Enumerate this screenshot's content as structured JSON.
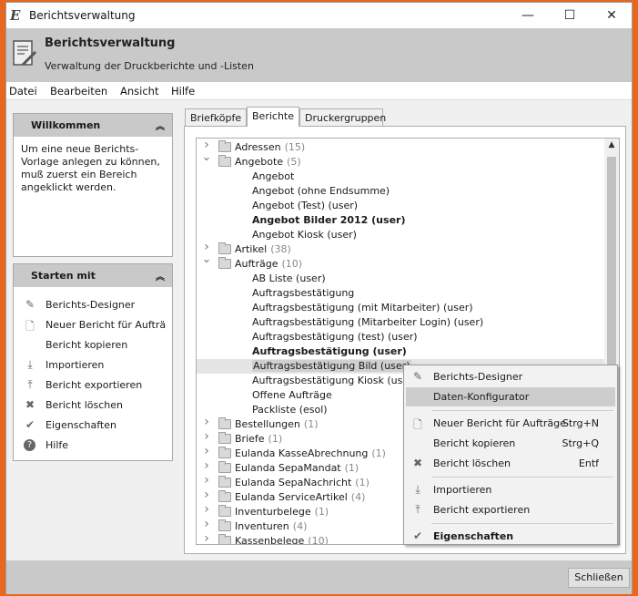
{
  "window": {
    "title": "Berichtsverwaltung",
    "controls": {
      "minimize": "—",
      "maximize": "☐",
      "close": "✕"
    }
  },
  "header": {
    "title": "Berichtsverwaltung",
    "subtitle": "Verwaltung der Druckberichte und -Listen"
  },
  "menu": [
    "Datei",
    "Bearbeiten",
    "Ansicht",
    "Hilfe"
  ],
  "welcome": {
    "title": "Willkommen",
    "text": "Um eine neue Berichts-Vorlage anlegen zu können, muß zuerst ein Bereich angeklickt werden."
  },
  "start": {
    "title": "Starten mit",
    "items": [
      {
        "label": "Berichts-Designer",
        "icon": "pencil-icon"
      },
      {
        "label": "Neuer Bericht für Aufträ",
        "icon": "new-document-icon"
      },
      {
        "label": "Bericht kopieren",
        "icon": ""
      },
      {
        "label": "Importieren",
        "icon": "import-icon"
      },
      {
        "label": "Bericht exportieren",
        "icon": "export-icon"
      },
      {
        "label": "Bericht löschen",
        "icon": "delete-icon"
      },
      {
        "label": "Eigenschaften",
        "icon": "properties-icon"
      },
      {
        "label": "Hilfe",
        "icon": "help-icon"
      }
    ]
  },
  "tabs": [
    "Briefköpfe",
    "Berichte",
    "Druckergruppen"
  ],
  "active_tab": 1,
  "tree": [
    {
      "type": "folder",
      "label": "Adressen",
      "count": "(15)",
      "expanded": false
    },
    {
      "type": "folder",
      "label": "Angebote",
      "count": "(5)",
      "expanded": true
    },
    {
      "type": "leaf",
      "label": "Angebot"
    },
    {
      "type": "leaf",
      "label": "Angebot (ohne Endsumme)"
    },
    {
      "type": "leaf",
      "label": "Angebot (Test) (user)"
    },
    {
      "type": "leaf",
      "label": "Angebot Bilder 2012 (user)",
      "bold": true
    },
    {
      "type": "leaf",
      "label": "Angebot Kiosk (user)"
    },
    {
      "type": "folder",
      "label": "Artikel",
      "count": "(38)",
      "expanded": false
    },
    {
      "type": "folder",
      "label": "Aufträge",
      "count": "(10)",
      "expanded": true
    },
    {
      "type": "leaf",
      "label": "AB Liste (user)"
    },
    {
      "type": "leaf",
      "label": "Auftragsbestätigung"
    },
    {
      "type": "leaf",
      "label": "Auftragsbestätigung (mit Mitarbeiter) (user)"
    },
    {
      "type": "leaf",
      "label": "Auftragsbestätigung (Mitarbeiter Login) (user)"
    },
    {
      "type": "leaf",
      "label": "Auftragsbestätigung (test) (user)"
    },
    {
      "type": "leaf",
      "label": "Auftragsbestätigung (user)",
      "bold": true
    },
    {
      "type": "leaf",
      "label": "Auftragsbestätigung Bild (user)",
      "selected": true
    },
    {
      "type": "leaf",
      "label": "Auftragsbestätigung Kiosk (user)"
    },
    {
      "type": "leaf",
      "label": "Offene Aufträge"
    },
    {
      "type": "leaf",
      "label": "Packliste (esol)"
    },
    {
      "type": "folder",
      "label": "Bestellungen",
      "count": "(1)",
      "expanded": false
    },
    {
      "type": "folder",
      "label": "Briefe",
      "count": "(1)",
      "expanded": false
    },
    {
      "type": "folder",
      "label": "Eulanda KasseAbrechnung",
      "count": "(1)",
      "expanded": false
    },
    {
      "type": "folder",
      "label": "Eulanda SepaMandat",
      "count": "(1)",
      "expanded": false
    },
    {
      "type": "folder",
      "label": "Eulanda SepaNachricht",
      "count": "(1)",
      "expanded": false
    },
    {
      "type": "folder",
      "label": "Eulanda ServiceArtikel",
      "count": "(4)",
      "expanded": false
    },
    {
      "type": "folder",
      "label": "Inventurbelege",
      "count": "(1)",
      "expanded": false
    },
    {
      "type": "folder",
      "label": "Inventuren",
      "count": "(4)",
      "expanded": false
    },
    {
      "type": "folder",
      "label": "Kassenbelege",
      "count": "(10)",
      "expanded": false
    }
  ],
  "context_menu": [
    {
      "label": "Berichts-Designer",
      "shortcut": "",
      "icon": "pencil-icon"
    },
    {
      "label": "Daten-Konfigurator",
      "shortcut": "",
      "icon": "",
      "selected": true
    },
    {
      "sep": true
    },
    {
      "label": "Neuer Bericht für Aufträge",
      "shortcut": "Strg+N",
      "icon": "new-document-icon"
    },
    {
      "label": "Bericht kopieren",
      "shortcut": "Strg+Q",
      "icon": ""
    },
    {
      "label": "Bericht löschen",
      "shortcut": "Entf",
      "icon": "delete-icon"
    },
    {
      "sep": true
    },
    {
      "label": "Importieren",
      "shortcut": "",
      "icon": "import-icon"
    },
    {
      "label": "Bericht exportieren",
      "shortcut": "",
      "icon": "export-icon"
    },
    {
      "sep": true
    },
    {
      "label": "Eigenschaften",
      "shortcut": "",
      "icon": "properties-icon",
      "bold": true
    }
  ],
  "footer": {
    "close_label": "Schließen"
  }
}
